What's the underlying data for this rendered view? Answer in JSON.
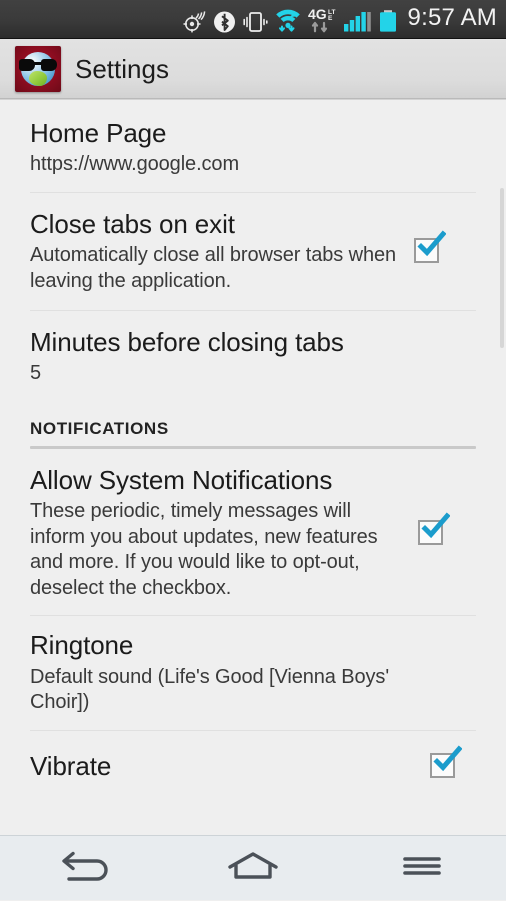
{
  "statusbar": {
    "time": "9:57 AM",
    "icons": [
      {
        "name": "gps-location-icon"
      },
      {
        "name": "bluetooth-icon"
      },
      {
        "name": "vibrate-mode-icon"
      },
      {
        "name": "wifi-signal-icon"
      },
      {
        "name": "4g-lte-data-icon"
      },
      {
        "name": "cellular-signal-icon"
      },
      {
        "name": "battery-icon"
      }
    ],
    "accent_color": "#23d3e8",
    "background_color": "#3a3a3a"
  },
  "titlebar": {
    "title": "Settings",
    "app_icon": "browser-globe-sunglasses-icon",
    "background_color": "#dcdcdc"
  },
  "settings": {
    "items": [
      {
        "id": "home-page",
        "title": "Home Page",
        "summary": "https://www.google.com",
        "control": "none"
      },
      {
        "id": "close-tabs-on-exit",
        "title": "Close tabs on exit",
        "summary": "Automatically close all browser tabs when leaving the application.",
        "control": "checkbox",
        "checked": true
      },
      {
        "id": "minutes-before-closing-tabs",
        "title": "Minutes before closing tabs",
        "summary": "5",
        "control": "none"
      }
    ],
    "section": {
      "header": "NOTIFICATIONS",
      "items": [
        {
          "id": "allow-system-notifications",
          "title": "Allow System Notifications",
          "summary": "These periodic, timely messages will inform you about updates, new features and more. If you would like to opt-out, deselect the checkbox.",
          "control": "checkbox",
          "checked": true
        },
        {
          "id": "ringtone",
          "title": "Ringtone",
          "summary": "Default sound (Life's Good [Vienna Boys' Choir])",
          "control": "none"
        },
        {
          "id": "vibrate",
          "title": "Vibrate",
          "summary": "",
          "control": "checkbox",
          "checked": true
        }
      ]
    },
    "checkbox_color": "#1b9ccc",
    "background_color": "#efefef"
  },
  "navbar": {
    "buttons": [
      {
        "name": "back-button",
        "icon": "back-arrow-icon"
      },
      {
        "name": "home-button",
        "icon": "home-icon"
      },
      {
        "name": "menu-button",
        "icon": "menu-hamburger-icon"
      }
    ],
    "background_color": "#e8ecef"
  }
}
